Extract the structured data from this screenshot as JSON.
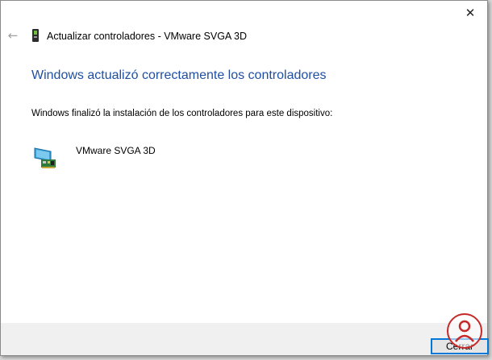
{
  "window": {
    "title": "Actualizar controladores - VMware SVGA 3D",
    "close_glyph": "✕",
    "back_glyph": "←"
  },
  "main": {
    "heading": "Windows actualizó correctamente los controladores",
    "description": "Windows finalizó la instalación de los controladores para este dispositivo:",
    "device_name": "VMware SVGA 3D"
  },
  "footer": {
    "close_label": "Cerrar"
  },
  "icons": {
    "title": "device-manager-icon",
    "device": "display-adapter-icon",
    "watermark": "solvetic-logo-icon"
  },
  "colors": {
    "heading": "#1f4fa3",
    "focus_border": "#0078d7"
  }
}
